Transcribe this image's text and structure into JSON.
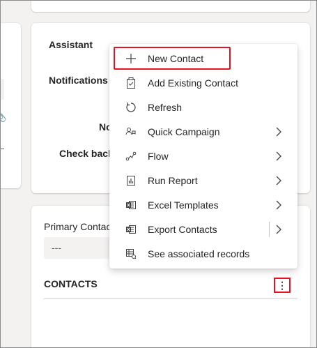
{
  "assistant": {
    "label": "Assistant"
  },
  "notifications": {
    "label": "Notifications"
  },
  "partial_labels": {
    "no": "No",
    "check_back": "Check back"
  },
  "primary_contact": {
    "label": "Primary Contac",
    "value": "---"
  },
  "contacts": {
    "title": "CONTACTS",
    "more_glyph": "⋮"
  },
  "menu": {
    "items": [
      {
        "label": "New Contact",
        "icon": "plus-icon",
        "submenu": false,
        "highlighted": true
      },
      {
        "label": "Add Existing Contact",
        "icon": "clipboard-icon",
        "submenu": false
      },
      {
        "label": "Refresh",
        "icon": "refresh-icon",
        "submenu": false
      },
      {
        "label": "Quick Campaign",
        "icon": "campaign-icon",
        "submenu": true
      },
      {
        "label": "Flow",
        "icon": "flow-icon",
        "submenu": true
      },
      {
        "label": "Run Report",
        "icon": "report-icon",
        "submenu": true
      },
      {
        "label": "Excel Templates",
        "icon": "excel-icon",
        "submenu": true
      },
      {
        "label": "Export Contacts",
        "icon": "excel-export-icon",
        "submenu": true,
        "split": true
      },
      {
        "label": "See associated records",
        "icon": "associated-records-icon",
        "submenu": false
      }
    ]
  },
  "colors": {
    "highlight": "#e81123",
    "accent_line": "#2c6a88",
    "attachment": "#7a2f8f"
  }
}
